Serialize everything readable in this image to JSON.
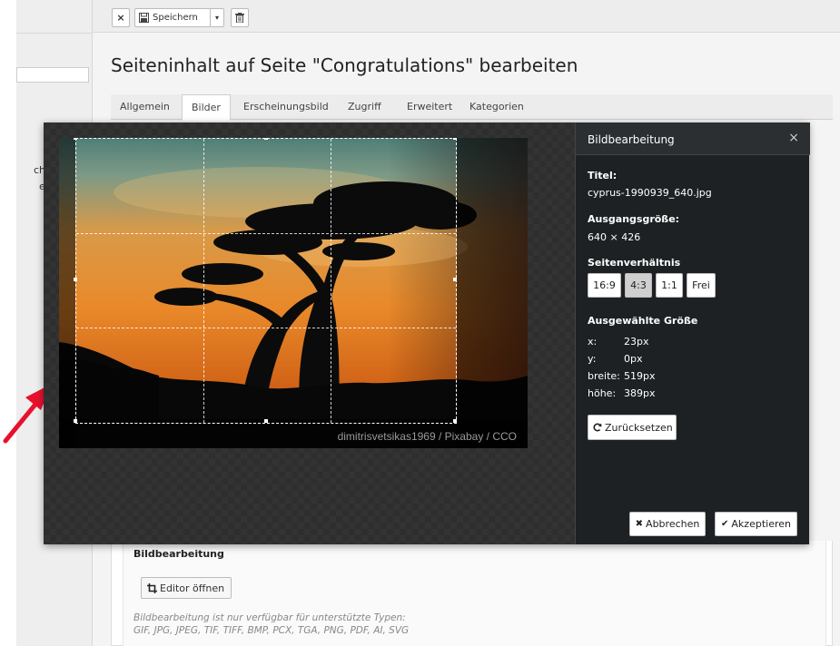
{
  "left": {
    "line1": "chara",
    "line2": "ext"
  },
  "toolbar": {
    "close_icon": "×",
    "save_label": "Speichern",
    "caret": "▾"
  },
  "page_title": "Seiteninhalt auf Seite \"Congratulations\" bearbeiten",
  "tabs": [
    "Allgemein",
    "Bilder",
    "Erscheinungsbild",
    "Zugriff",
    "Erweitert",
    "Kategorien"
  ],
  "active_tab": "Bilder",
  "bottom": {
    "section_title": "Bildbearbeitung",
    "open_editor": "Editor öffnen",
    "hint_line1": "Bildbearbeitung ist nur verfügbar für unterstützte Typen:",
    "hint_line2": "GIF, JPG, JPEG, TIF, TIFF, BMP, PCX, TGA, PNG, PDF, AI, SVG"
  },
  "modal": {
    "title": "Bildbearbeitung",
    "close": "×",
    "credit": "dimitrisvetsikas1969 / Pixabay / CCO",
    "title_label": "Titel:",
    "title_value": "cyprus-1990939_640.jpg",
    "orig_label": "Ausgangsgröße:",
    "orig_value": "640 × 426",
    "ratio_label": "Seitenverhältnis",
    "ratios": [
      "16:9",
      "4:3",
      "1:1",
      "Frei"
    ],
    "selected_ratio": "4:3",
    "selected_label": "Ausgewählte Größe",
    "sel": {
      "x_key": "x:",
      "x_val": "23px",
      "y_key": "y:",
      "y_val": "0px",
      "w_key": "breite:",
      "w_val": "519px",
      "h_key": "höhe:",
      "h_val": "389px"
    },
    "reset": "Zurücksetzen",
    "cancel": "Abbrechen",
    "accept": "Akzeptieren"
  },
  "colors": {
    "modal_bg": "#2d2d2d",
    "sidebar_bg": "#1e2123",
    "arrow": "#e8112d"
  }
}
